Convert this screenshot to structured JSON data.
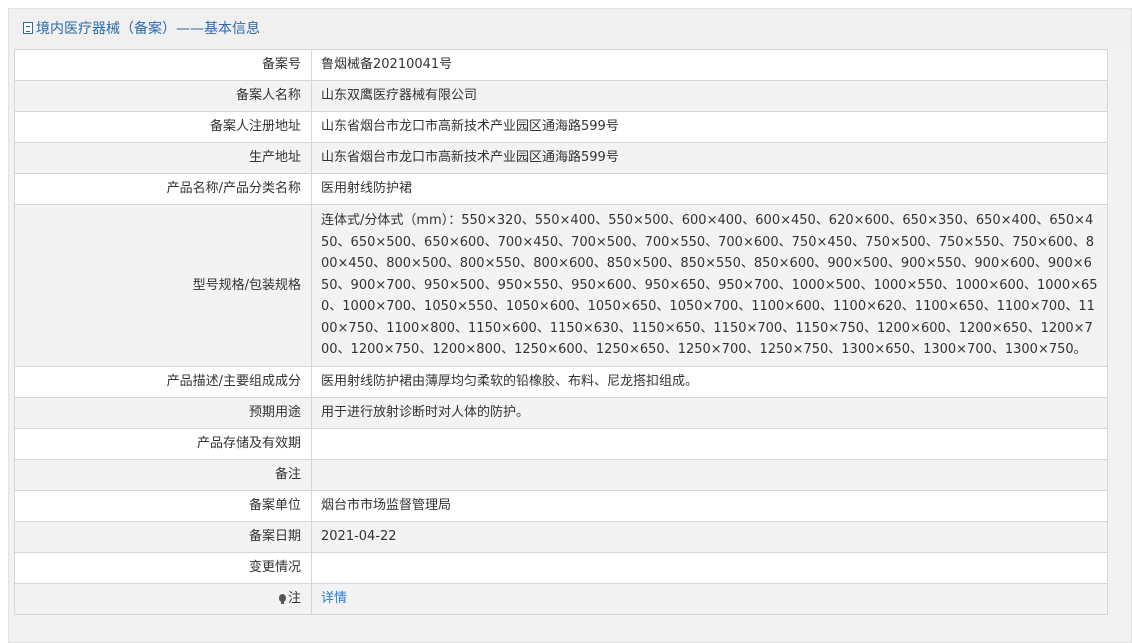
{
  "header": {
    "title": "境内医疗器械（备案）——基本信息"
  },
  "rows": {
    "record_no": {
      "label": "备案号",
      "value": "鲁烟械备20210041号"
    },
    "registrant": {
      "label": "备案人名称",
      "value": "山东双鹰医疗器械有限公司"
    },
    "reg_address": {
      "label": "备案人注册地址",
      "value": "山东省烟台市龙口市高新技术产业园区通海路599号"
    },
    "prod_address": {
      "label": "生产地址",
      "value": "山东省烟台市龙口市高新技术产业园区通海路599号"
    },
    "product_name": {
      "label": "产品名称/产品分类名称",
      "value": "医用射线防护裙"
    },
    "spec": {
      "label": "型号规格/包装规格",
      "value": "连体式/分体式（mm）：550×320、550×400、550×500、600×400、600×450、620×600、650×350、650×400、650×450、650×500、650×600、700×450、700×500、700×550、700×600、750×450、750×500、750×550、750×600、800×450、800×500、800×550、800×600、850×500、850×550、850×600、900×500、900×550、900×600、900×650、900×700、950×500、950×550、950×600、950×650、950×700、1000×500、1000×550、1000×600、1000×650、1000×700、1050×550、1050×600、1050×650、1050×700、1100×600、1100×620、1100×650、1100×700、1100×750、1100×800、1150×600、1150×630、1150×650、1150×700、1150×750、1200×600、1200×650、1200×700、1200×750、1200×800、1250×600、1250×650、1250×700、1250×750、1300×650、1300×700、1300×750。"
    },
    "description": {
      "label": "产品描述/主要组成成分",
      "value": "医用射线防护裙由薄厚均匀柔软的铅橡胶、布料、尼龙搭扣组成。"
    },
    "intended_use": {
      "label": "预期用途",
      "value": "用于进行放射诊断时对人体的防护。"
    },
    "storage": {
      "label": "产品存储及有效期",
      "value": ""
    },
    "remarks": {
      "label": "备注",
      "value": ""
    },
    "authority": {
      "label": "备案单位",
      "value": "烟台市市场监督管理局"
    },
    "record_date": {
      "label": "备案日期",
      "value": "2021-04-22"
    },
    "changes": {
      "label": "变更情况",
      "value": ""
    },
    "note": {
      "label": "注",
      "link_text": "详情",
      "icon": "bulb-icon"
    }
  }
}
